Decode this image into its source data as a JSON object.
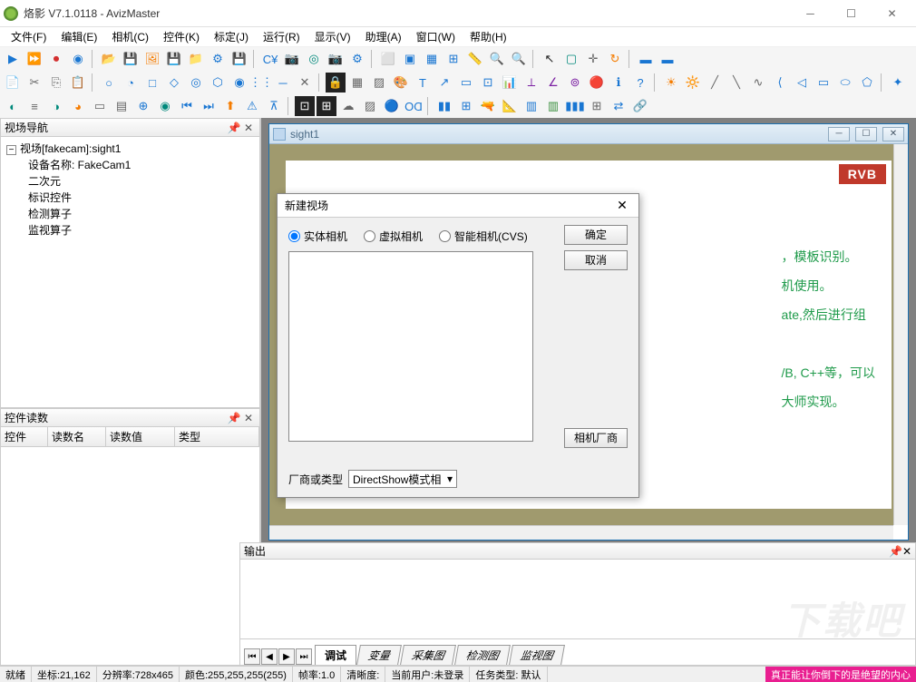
{
  "window": {
    "title": "烙影 V7.1.0118 - AvizMaster"
  },
  "menu": [
    "文件(F)",
    "编辑(E)",
    "相机(C)",
    "控件(K)",
    "标定(J)",
    "运行(R)",
    "显示(V)",
    "助理(A)",
    "窗口(W)",
    "帮助(H)"
  ],
  "panels": {
    "nav": {
      "title": "视场导航",
      "root": "视场[fakecam]:sight1",
      "children": [
        "设备名称: FakeCam1",
        "二次元",
        "标识控件",
        "检测算子",
        "监视算子"
      ]
    },
    "readings": {
      "title": "控件读数",
      "columns": [
        "控件",
        "读数名",
        "读数值",
        "类型"
      ]
    },
    "output": {
      "title": "输出",
      "tabs": [
        "调试",
        "变量",
        "采集图",
        "检测图",
        "监视图"
      ]
    }
  },
  "mdi": {
    "title": "sight1",
    "badge": "RVB",
    "lines": [
      "，模板识别。",
      "机使用。",
      "ate,然后进行组",
      "/B, C++等，可以",
      "大师实现。"
    ]
  },
  "dialog": {
    "title": "新建视场",
    "radios": [
      "实体相机",
      "虚拟相机",
      "智能相机(CVS)"
    ],
    "ok": "确定",
    "cancel": "取消",
    "vendor_btn": "相机厂商",
    "vendor_label": "厂商或类型",
    "vendor_select": "DirectShow模式相"
  },
  "status": {
    "ready": "就绪",
    "coord": "坐标:21,162",
    "res": "分辨率:728x465",
    "color": "颜色:255,255,255(255)",
    "fps": "帧率:1.0",
    "clarity": "清晰度:",
    "user": "当前用户:未登录",
    "task": "任务类型: 默认",
    "pink": "真正能让你倒下的是绝望的内心"
  },
  "watermark": "下载吧"
}
